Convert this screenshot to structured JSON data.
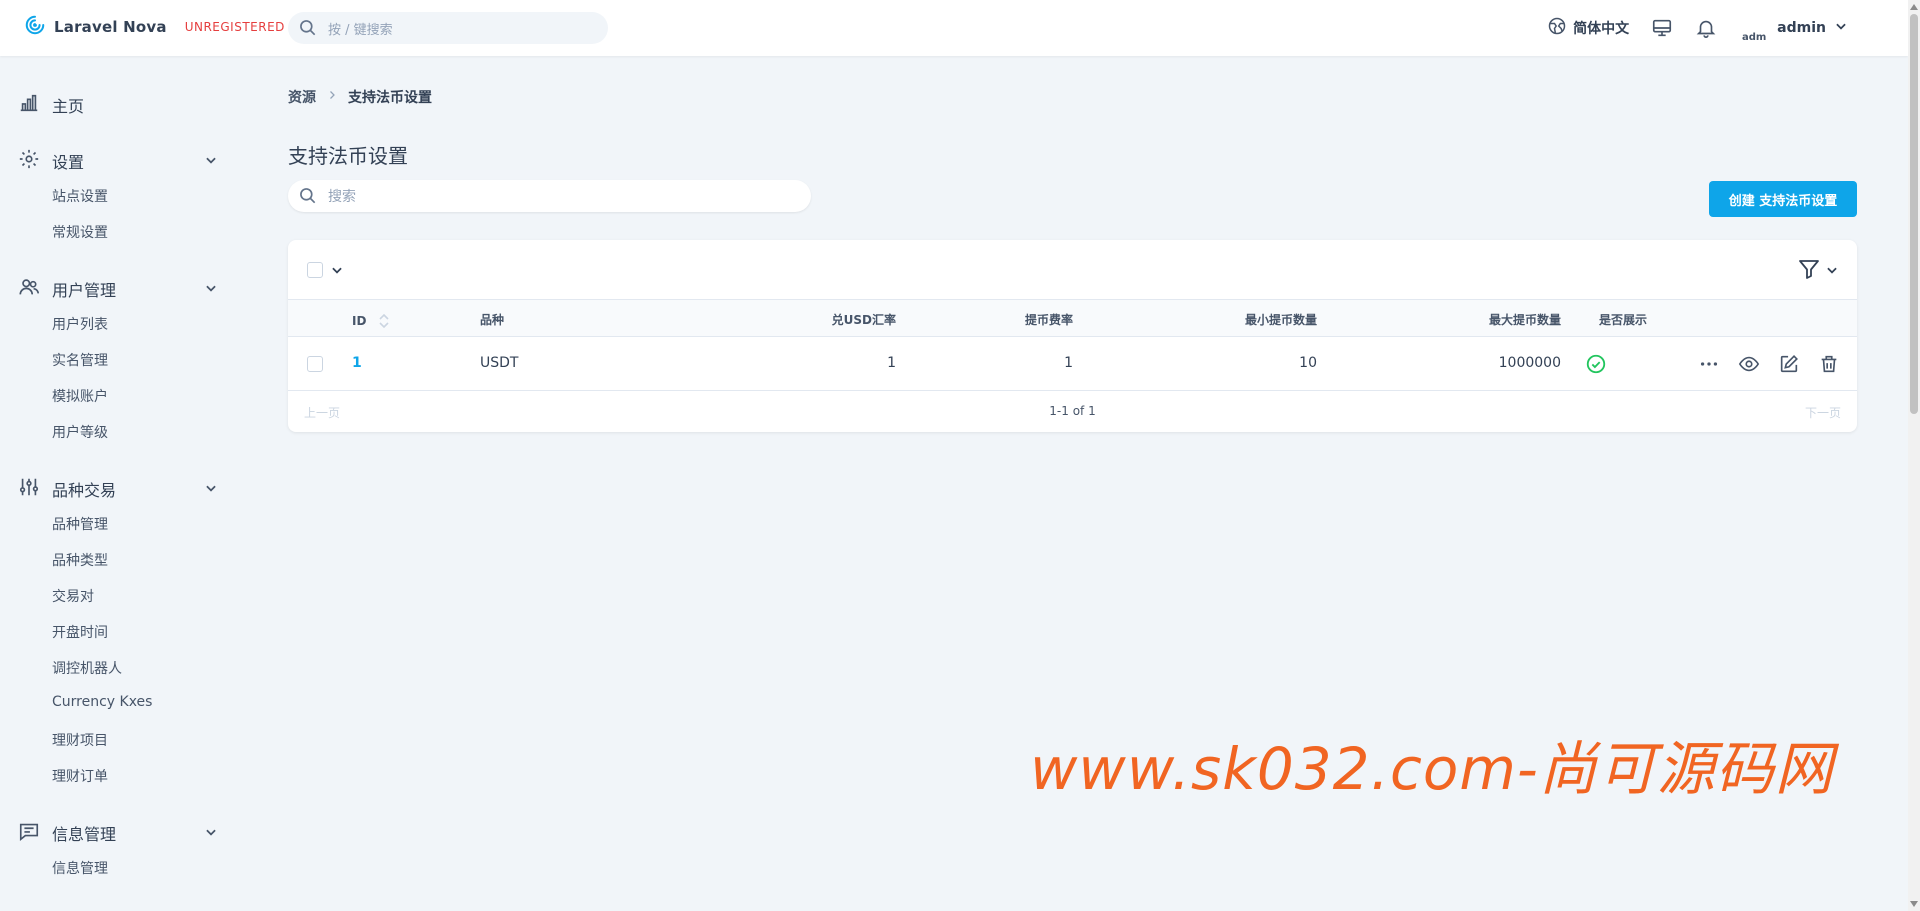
{
  "header": {
    "brand_name": "Laravel Nova",
    "brand_status": "UNREGISTERED",
    "search_placeholder": "按 / 键搜索",
    "language": "简体中文",
    "avatar_alt": "adm",
    "user_name": "admin"
  },
  "sidebar": {
    "sections": [
      {
        "label": "主页",
        "icon": "chart-bar-icon",
        "items": []
      },
      {
        "label": "设置",
        "icon": "gear-icon",
        "items": [
          "站点设置",
          "常规设置"
        ]
      },
      {
        "label": "用户管理",
        "icon": "users-icon",
        "items": [
          "用户列表",
          "实名管理",
          "模拟账户",
          "用户等级"
        ]
      },
      {
        "label": "品种交易",
        "icon": "sliders-icon",
        "items": [
          "品种管理",
          "品种类型",
          "交易对",
          "开盘时间",
          "调控机器人",
          "Currency Kxes",
          "理财项目",
          "理财订单"
        ]
      },
      {
        "label": "信息管理",
        "icon": "chat-icon",
        "items": [
          "信息管理"
        ]
      }
    ]
  },
  "breadcrumb": {
    "root": "资源",
    "current": "支持法币设置"
  },
  "page": {
    "title": "支持法币设置",
    "search_placeholder": "搜索",
    "create_label": "创建 支持法币设置"
  },
  "table": {
    "columns": [
      "ID",
      "品种",
      "兑USD汇率",
      "提币费率",
      "最小提币数量",
      "最大提币数量",
      "是否展示"
    ],
    "rows": [
      {
        "id": "1",
        "symbol": "USDT",
        "rate": "1",
        "fee": "1",
        "min": "10",
        "max": "1000000",
        "shown": true
      }
    ]
  },
  "pagination": {
    "prev": "上一页",
    "info": "1-1 of 1",
    "next": "下一页"
  },
  "watermark": "www.sk032.com-尚可源码网",
  "colors": {
    "accent": "#0ea5e9",
    "success": "#22c55e",
    "brand": "#0ea5e9",
    "danger": "#e53e3e"
  }
}
